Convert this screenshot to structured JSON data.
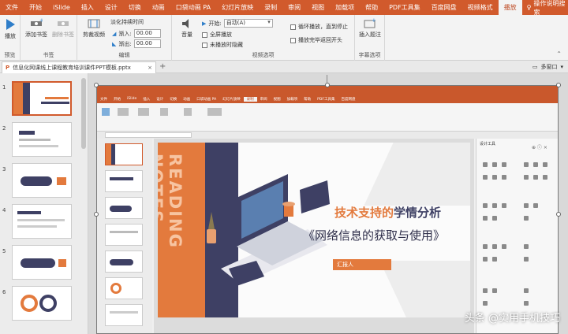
{
  "ribbon_tabs": [
    "文件",
    "开始",
    "iSlide",
    "插入",
    "设计",
    "切换",
    "动画",
    "口袋动画 PA",
    "幻灯片放映",
    "录制",
    "审阅",
    "视图",
    "加载项",
    "帮助",
    "PDF工具集",
    "百度网盘",
    "视频格式",
    "播放"
  ],
  "active_tab": "播放",
  "tell_me": "操作说明搜索",
  "preview": {
    "play_label": "播放",
    "group": "预览"
  },
  "bookmarks": {
    "add": "添加书签",
    "remove": "删除书签",
    "group": "书签"
  },
  "editing": {
    "trim": "剪裁视频",
    "fade_title": "淡化持续时间",
    "fade_in_label": "渐入:",
    "fade_in_value": "00.00",
    "fade_out_label": "渐出:",
    "fade_out_value": "00.00",
    "group": "编辑"
  },
  "video_options": {
    "volume": "音量",
    "start_label": "开始:",
    "start_value": "自动(A)",
    "fullscreen": "全屏播放",
    "hide": "未播放时隐藏",
    "loop": "循环播放，直到停止",
    "rewind": "播放完毕返回开头",
    "group": "视频选项"
  },
  "captions": {
    "insert": "插入题注",
    "group": "字幕选项"
  },
  "doc_tab": {
    "name": "信息化网课线上课程教育培训课件PPT模板.pptx"
  },
  "multi_window": "多窗口",
  "thumbnails": [
    "1",
    "2",
    "3",
    "4",
    "5",
    "6"
  ],
  "inner_tabs": [
    "文件",
    "开始",
    "iSlide",
    "插入",
    "设计",
    "切换",
    "动画",
    "口袋动画 PA",
    "幻灯片放映",
    "录制",
    "审阅",
    "视图",
    "加载项",
    "帮助",
    "PDF工具集",
    "百度网盘"
  ],
  "inner_active_tab": "录制",
  "slide": {
    "vertical_text": "READING NOTES",
    "title_part1": "技术支持的",
    "title_part2": "学情分析",
    "subtitle": "《网络信息的获取与使用》",
    "reporter": "汇报人"
  },
  "design_pane": {
    "title": "设计工具"
  },
  "watermark": "头条 @实用手机技巧",
  "colors": {
    "accent": "#d15a2c",
    "slide_orange": "#e37a3d",
    "slide_navy": "#3e4064"
  }
}
